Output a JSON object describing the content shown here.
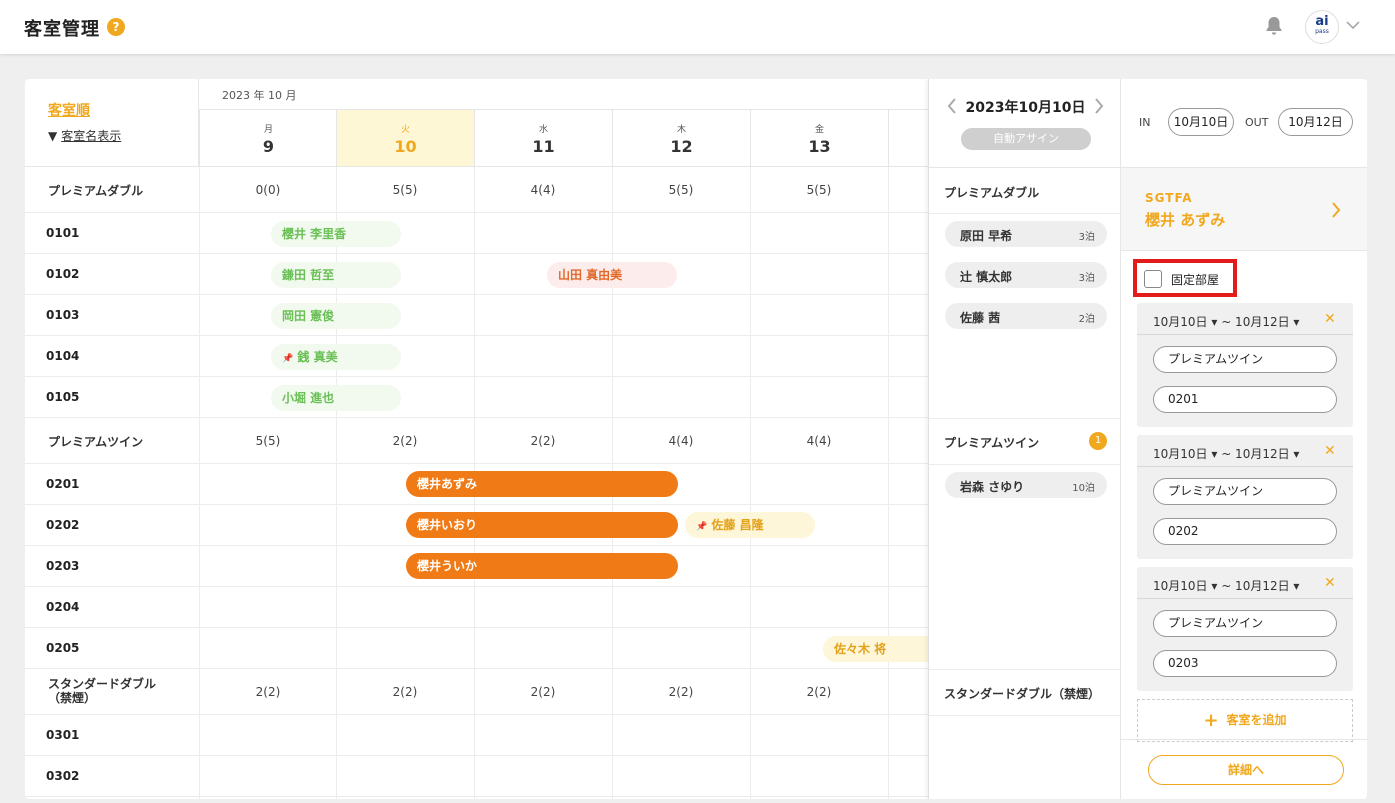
{
  "header": {
    "title": "客室管理",
    "help_glyph": "?",
    "logo_text": "ai",
    "logo_sub": "pass"
  },
  "calendar": {
    "sort_label": "客室順",
    "name_toggle_label": "客室名表示",
    "month_label": "2023 年 10 月",
    "days": [
      {
        "dow": "月",
        "num": "9"
      },
      {
        "dow": "火",
        "num": "10"
      },
      {
        "dow": "水",
        "num": "11"
      },
      {
        "dow": "木",
        "num": "12"
      },
      {
        "dow": "金",
        "num": "13"
      }
    ],
    "groups": [
      {
        "name": "プレミアムダブル",
        "counts": [
          "0(0)",
          "5(5)",
          "4(4)",
          "5(5)",
          "5(5)"
        ],
        "rooms": [
          "0101",
          "0102",
          "0103",
          "0104",
          "0105"
        ]
      },
      {
        "name": "プレミアムツイン",
        "counts": [
          "5(5)",
          "2(2)",
          "2(2)",
          "4(4)",
          "4(4)"
        ],
        "rooms": [
          "0201",
          "0202",
          "0203",
          "0204",
          "0205"
        ]
      },
      {
        "name": "スタンダードダブル（禁煙）",
        "name_line1": "スタンダードダブル",
        "name_line2": "（禁煙）",
        "counts": [
          "2(2)",
          "2(2)",
          "2(2)",
          "2(2)",
          "2(2)"
        ],
        "rooms": [
          "0301",
          "0302"
        ]
      }
    ],
    "reservations": [
      {
        "guest": "櫻井 李里香",
        "room": "0101",
        "style": "green"
      },
      {
        "guest": "鎌田 哲至",
        "room": "0102",
        "style": "green"
      },
      {
        "guest": "山田 真由美",
        "room": "0102",
        "style": "red"
      },
      {
        "guest": "岡田 憲俊",
        "room": "0103",
        "style": "green"
      },
      {
        "guest": "銭 真美",
        "room": "0104",
        "style": "green",
        "pinned": true
      },
      {
        "guest": "小堀 進也",
        "room": "0105",
        "style": "green"
      },
      {
        "guest": "櫻井あずみ",
        "room": "0201",
        "style": "orange"
      },
      {
        "guest": "櫻井いおり",
        "room": "0202",
        "style": "orange"
      },
      {
        "guest": "佐藤 昌隆",
        "room": "0202",
        "style": "yellow",
        "pinned": true
      },
      {
        "guest": "櫻井ういか",
        "room": "0203",
        "style": "orange"
      },
      {
        "guest": "佐々木 将",
        "room": "0205",
        "style": "yellow"
      }
    ],
    "pin_glyph": "📌"
  },
  "unassigned": {
    "date": "2023年10月10日",
    "auto_assign_label": "自動アサイン",
    "groups": [
      {
        "name": "プレミアムダブル",
        "guests": [
          {
            "name": "原田 早希",
            "nights": "3泊"
          },
          {
            "name": "辻 慎太郎",
            "nights": "3泊"
          },
          {
            "name": "佐藤 茜",
            "nights": "2泊"
          }
        ]
      },
      {
        "name": "プレミアムツイン",
        "badge": "1",
        "guests": [
          {
            "name": "岩森 さゆり",
            "nights": "10泊"
          }
        ]
      },
      {
        "name": "スタンダードダブル（禁煙）",
        "guests": []
      }
    ]
  },
  "detail": {
    "in_label": "IN",
    "in_date": "10月10日",
    "out_label": "OUT",
    "out_date": "10月12日",
    "guest_code": "SGTFA",
    "guest_name": "櫻井 あずみ",
    "fixed_room_label": "固定部屋",
    "fixed_room_checked": false,
    "assignments": [
      {
        "dates": "10月10日 ▾ ~ 10月12日 ▾",
        "room_type": "プレミアムツイン",
        "room": "0201"
      },
      {
        "dates": "10月10日 ▾ ~ 10月12日 ▾",
        "room_type": "プレミアムツイン",
        "room": "0202"
      },
      {
        "dates": "10月10日 ▾ ~ 10月12日 ▾",
        "room_type": "プレミアムツイン",
        "room": "0203"
      }
    ],
    "add_room_label": "客室を追加",
    "details_button_label": "詳細へ"
  },
  "colors": {
    "accent": "#f0a81e",
    "reserved_orange": "#f07a16",
    "fixed_highlight": "#e21b1b",
    "today_bg": "#fdf7d6"
  }
}
